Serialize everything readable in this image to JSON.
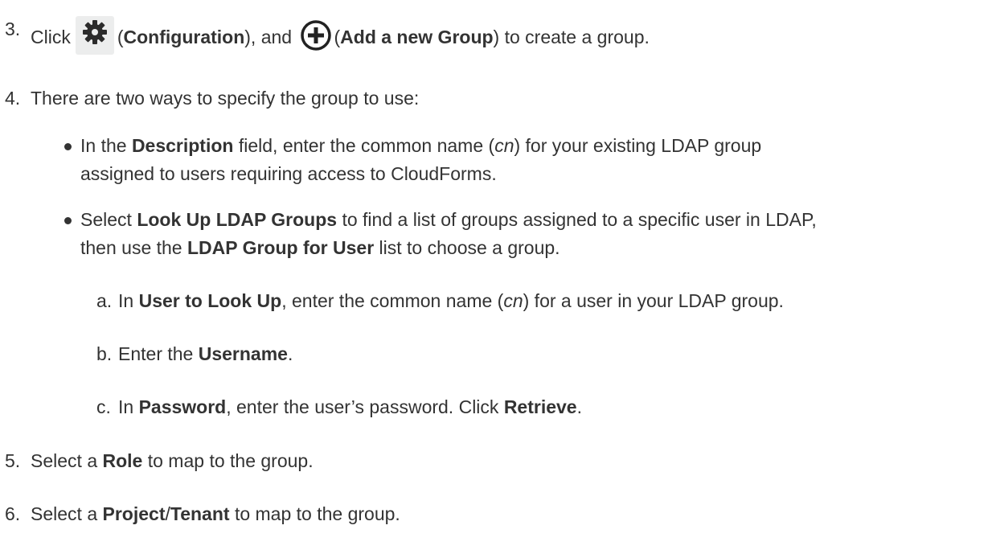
{
  "steps": {
    "s3": {
      "num": "3.",
      "click": "Click",
      "open1": "(",
      "configuration": "Configuration",
      "close1": "), and",
      "open2": "(",
      "add_group": "Add a new Group",
      "close2": ") to create a group.",
      "icons": [
        "gear-icon",
        "add-circle-icon"
      ]
    },
    "s4": {
      "num": "4.",
      "text": "There are two ways to specify the group to use:",
      "b1": {
        "t1": "In the",
        "description": "Description",
        "t2": "field, enter the common name (",
        "cn": "cn",
        "t3": ") for your existing LDAP group",
        "line2": "assigned to users requiring access to CloudForms."
      },
      "b2": {
        "t1": "Select",
        "lookup": "Look Up LDAP Groups",
        "t2": "to find a list of groups assigned to a specific user in LDAP,",
        "t3": "then use the",
        "ldap_group_user": "LDAP Group for User",
        "t4": "list to choose a group.",
        "sub": {
          "a": {
            "label": "a.",
            "t1": "In",
            "user_lookup": "User to Look Up",
            "t2": ", enter the common name (",
            "cn": "cn",
            "t3": ") for a user in your LDAP group."
          },
          "b": {
            "label": "b.",
            "t1": "Enter the",
            "username": "Username",
            "t2": "."
          },
          "c": {
            "label": "c.",
            "t1": "In",
            "password": "Password",
            "t2": ", enter the user’s password. Click",
            "retrieve": "Retrieve",
            "t3": "."
          }
        }
      }
    },
    "s5": {
      "num": "5.",
      "t1": "Select a",
      "role": "Role",
      "t2": "to map to the group."
    },
    "s6": {
      "num": "6.",
      "t1": "Select a",
      "project": "Project",
      "slash": "/",
      "tenant": "Tenant",
      "t2": "to map to the group."
    }
  },
  "colors": {
    "text": "#333333",
    "icon": "#222222",
    "icon_bg": "#eceded"
  }
}
